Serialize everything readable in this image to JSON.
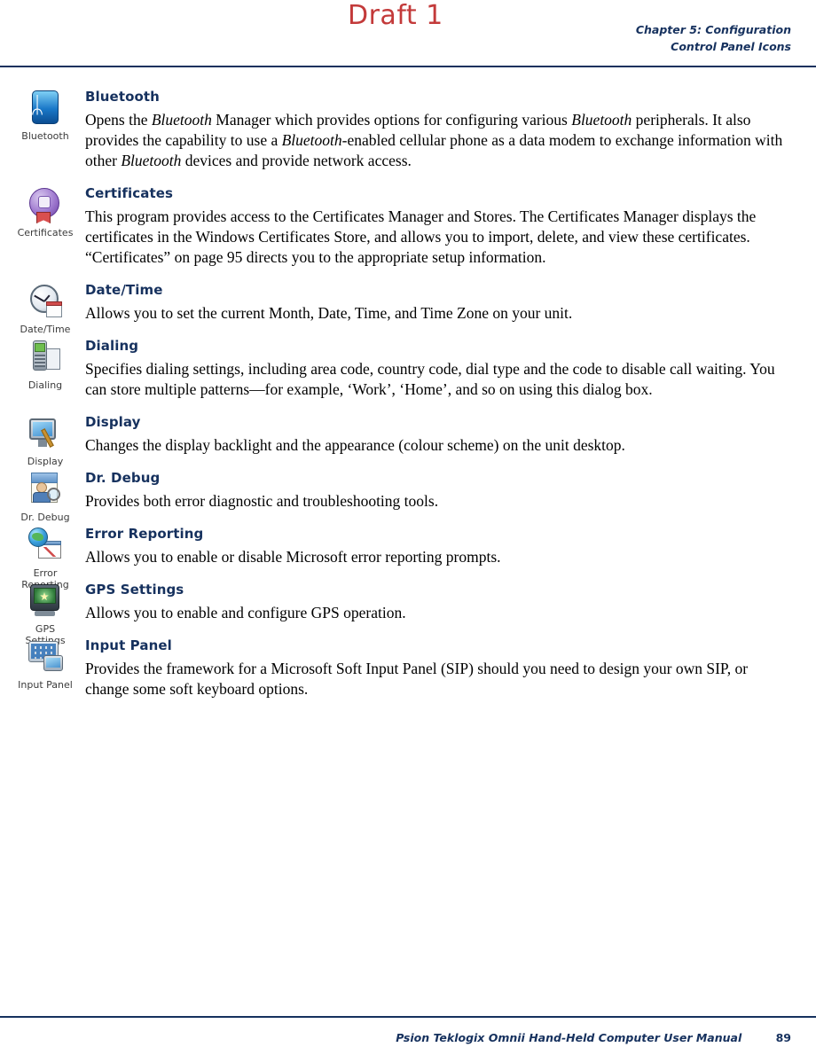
{
  "watermark": "Draft 1",
  "header": {
    "line1": "Chapter 5: Configuration",
    "line2": "Control Panel Icons"
  },
  "footer": {
    "text": "Psion Teklogix Omnii Hand-Held Computer User Manual",
    "page": "89"
  },
  "entries": [
    {
      "icon": "bluetooth-icon",
      "caption": "Bluetooth",
      "title": "Bluetooth",
      "paragraphs": [
        {
          "runs": [
            {
              "t": "Opens the ",
              "i": false
            },
            {
              "t": "Bluetooth",
              "i": true
            },
            {
              "t": " Manager which provides options for configuring various ",
              "i": false
            },
            {
              "t": "Bluetooth",
              "i": true
            },
            {
              "t": " peripherals. It also provides the capability to use a ",
              "i": false
            },
            {
              "t": "Bluetooth",
              "i": true
            },
            {
              "t": "-enabled cellular phone as a data modem to exchange information with other ",
              "i": false
            },
            {
              "t": "Bluetooth",
              "i": true
            },
            {
              "t": " devices and provide network access.",
              "i": false
            }
          ]
        }
      ]
    },
    {
      "icon": "certificates-icon",
      "caption": "Certificates",
      "title": "Certificates",
      "paragraphs": [
        {
          "runs": [
            {
              "t": "This program provides access to the Certificates Manager and Stores. The Certificates Manager displays the certificates in the Windows Certificates Store, and allows you to import, delete, and view these certificates. “Certificates” on page 95 directs you to the appropriate setup information.",
              "i": false
            }
          ]
        }
      ]
    },
    {
      "icon": "date-time-icon",
      "caption": "Date/Time",
      "title": "Date/Time",
      "paragraphs": [
        {
          "runs": [
            {
              "t": "Allows you to set the current Month, Date, Time, and Time Zone on your unit.",
              "i": false
            }
          ]
        }
      ]
    },
    {
      "icon": "dialing-icon",
      "caption": "Dialing",
      "title": "Dialing",
      "paragraphs": [
        {
          "runs": [
            {
              "t": "Specifies dialing settings, including area code, country code, dial type and the code to disable call waiting. You can store multiple patterns—for example, ‘Work’, ‘Home’, and so on using this dialog box.",
              "i": false
            }
          ]
        }
      ]
    },
    {
      "icon": "display-icon",
      "caption": "Display",
      "title": "Display",
      "paragraphs": [
        {
          "runs": [
            {
              "t": "Changes the display backlight and the appearance (colour scheme) on the unit desktop.",
              "i": false
            }
          ]
        }
      ]
    },
    {
      "icon": "dr-debug-icon",
      "caption": "Dr. Debug",
      "title": "Dr. Debug",
      "paragraphs": [
        {
          "runs": [
            {
              "t": "Provides both error diagnostic and troubleshooting tools.",
              "i": false
            }
          ]
        }
      ]
    },
    {
      "icon": "error-reporting-icon",
      "caption": "Error\nReporting",
      "title": "Error Reporting",
      "paragraphs": [
        {
          "runs": [
            {
              "t": "Allows you to enable or disable Microsoft error reporting prompts.",
              "i": false
            }
          ]
        }
      ]
    },
    {
      "icon": "gps-settings-icon",
      "caption": "GPS\nSettings",
      "title": "GPS Settings",
      "paragraphs": [
        {
          "runs": [
            {
              "t": "Allows you to enable and configure GPS operation.",
              "i": false
            }
          ]
        }
      ]
    },
    {
      "icon": "input-panel-icon",
      "caption": "Input Panel",
      "title": "Input Panel",
      "paragraphs": [
        {
          "runs": [
            {
              "t": "Provides the framework for a Microsoft Soft Input Panel (SIP) should you need to design your own SIP, or change some soft keyboard options.",
              "i": false
            }
          ]
        }
      ]
    }
  ]
}
